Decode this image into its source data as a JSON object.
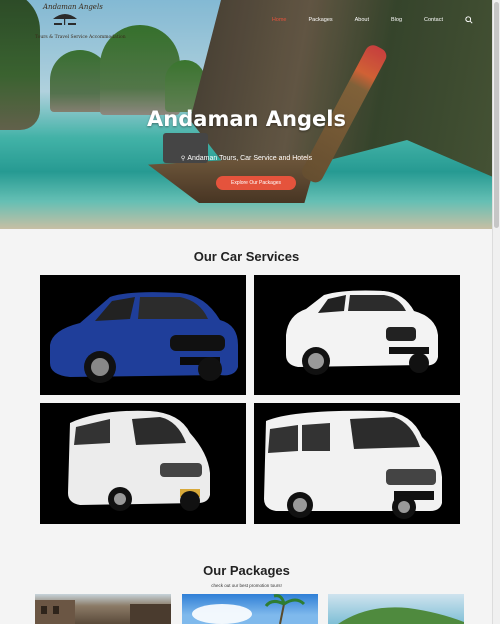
{
  "brand": {
    "name": "Andaman Angels",
    "tagline": "Tours & Travel Service Accommodation"
  },
  "nav": {
    "items": [
      {
        "label": "Home",
        "active": true
      },
      {
        "label": "Packages",
        "active": false
      },
      {
        "label": "About",
        "active": false
      },
      {
        "label": "Blog",
        "active": false
      },
      {
        "label": "Contact",
        "active": false
      }
    ],
    "search_icon": "search-icon"
  },
  "hero": {
    "title": "Andaman Angels",
    "subtitle": "Andaman Tours, Car Service and Hotels",
    "location_icon": "map-pin-icon",
    "cta_label": "Explore Our Packages"
  },
  "car_services": {
    "title": "Our Car Services",
    "items": [
      {
        "name": "blue-hatchback",
        "color": "#1f3e9a"
      },
      {
        "name": "white-suv",
        "color": "#ffffff"
      },
      {
        "name": "white-van-small",
        "color": "#e9e9e9"
      },
      {
        "name": "white-van-large",
        "color": "#f2f2f2"
      }
    ]
  },
  "packages": {
    "title": "Our Packages",
    "subtitle": "check out our best promotion tours!"
  },
  "colors": {
    "accent": "#e5533c",
    "tile_bg": "#000000",
    "page_bg": "#f4f4f4"
  }
}
